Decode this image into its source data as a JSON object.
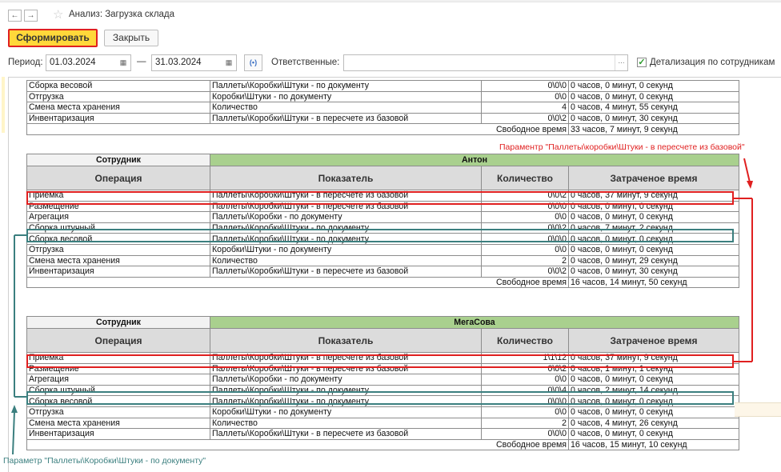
{
  "window": {
    "title": "Анализ: Загрузка склада"
  },
  "toolbar": {
    "generate_label": "Сформировать",
    "close_label": "Закрыть"
  },
  "filters": {
    "period_label": "Период:",
    "date_from": "01.03.2024",
    "dash": "—",
    "date_to": "31.03.2024",
    "responsible_label": "Ответственные:",
    "responsible_value": "",
    "detail_label": "Детализация по сотрудникам",
    "detail_checked": true
  },
  "columns": {
    "employee": "Сотрудник",
    "operation": "Операция",
    "indicator": "Показатель",
    "quantity": "Количество",
    "time": "Затраченое время"
  },
  "free_time_label": "Свободное время",
  "block0": {
    "rows": [
      {
        "operation": "Сборка весовой",
        "indicator": "Паллеты\\Коробки\\Штуки - по документу",
        "quantity": "0\\0\\0",
        "time": "0 часов, 0 минут, 0 секунд"
      },
      {
        "operation": "Отгрузка",
        "indicator": "Коробки\\Штуки - по документу",
        "quantity": "0\\0",
        "time": "0 часов, 0 минут, 0 секунд"
      },
      {
        "operation": "Смена места хранения",
        "indicator": "Количество",
        "quantity": "4",
        "time": "0 часов, 4 минут, 55 секунд"
      },
      {
        "operation": "Инвентаризация",
        "indicator": "Паллеты\\Коробки\\Штуки - в пересчете из базовой",
        "quantity": "0\\0\\2",
        "time": "0 часов, 0 минут, 30 секунд"
      }
    ],
    "free_time": "33 часов, 7 минут, 9 секунд"
  },
  "block1": {
    "employee": "Антон",
    "rows": [
      {
        "operation": "Приемка",
        "indicator": "Паллеты\\Коробки\\Штуки - в пересчете из базовой",
        "quantity": "0\\0\\2",
        "time": "0 часов, 37 минут, 9 секунд"
      },
      {
        "operation": "Размещение",
        "indicator": "Паллеты\\Коробки\\Штуки - в пересчете из базовой",
        "quantity": "0\\0\\0",
        "time": "0 часов, 0 минут, 0 секунд"
      },
      {
        "operation": "Агрегация",
        "indicator": "Паллеты\\Коробки - по документу",
        "quantity": "0\\0",
        "time": "0 часов, 0 минут, 0 секунд"
      },
      {
        "operation": "Сборка штучный",
        "indicator": "Паллеты\\Коробки\\Штуки - по документу",
        "quantity": "0\\0\\2",
        "time": "0 часов, 7 минут, 2 секунд"
      },
      {
        "operation": "Сборка весовой",
        "indicator": "Паллеты\\Коробки\\Штуки - по документу",
        "quantity": "0\\0\\0",
        "time": "0 часов, 0 минут, 0 секунд"
      },
      {
        "operation": "Отгрузка",
        "indicator": "Коробки\\Штуки - по документу",
        "quantity": "0\\0",
        "time": "0 часов, 0 минут, 0 секунд"
      },
      {
        "operation": "Смена места хранения",
        "indicator": "Количество",
        "quantity": "2",
        "time": "0 часов, 0 минут, 29 секунд"
      },
      {
        "operation": "Инвентаризация",
        "indicator": "Паллеты\\Коробки\\Штуки - в пересчете из базовой",
        "quantity": "0\\0\\2",
        "time": "0 часов, 0 минут, 30 секунд"
      }
    ],
    "free_time": "16 часов, 14 минут, 50 секунд"
  },
  "block2": {
    "employee": "МегаСова",
    "rows": [
      {
        "operation": "Приемка",
        "indicator": "Паллеты\\Коробки\\Штуки - в пересчете из базовой",
        "quantity": "1\\1\\12",
        "time": "0 часов, 37 минут, 9 секунд"
      },
      {
        "operation": "Размещение",
        "indicator": "Паллеты\\Коробки\\Штуки - в пересчете из базовой",
        "quantity": "0\\0\\2",
        "time": "0 часов, 1 минут, 1 секунд"
      },
      {
        "operation": "Агрегация",
        "indicator": "Паллеты\\Коробки - по документу",
        "quantity": "0\\0",
        "time": "0 часов, 0 минут, 0 секунд"
      },
      {
        "operation": "Сборка штучный",
        "indicator": "Паллеты\\Коробки\\Штуки - по документу",
        "quantity": "0\\0\\4",
        "time": "0 часов, 2 минут, 14 секунд"
      },
      {
        "operation": "Сборка весовой",
        "indicator": "Паллеты\\Коробки\\Штуки - по документу",
        "quantity": "0\\0\\0",
        "time": "0 часов, 0 минут, 0 секунд"
      },
      {
        "operation": "Отгрузка",
        "indicator": "Коробки\\Штуки - по документу",
        "quantity": "0\\0",
        "time": "0 часов, 0 минут, 0 секунд"
      },
      {
        "operation": "Смена места хранения",
        "indicator": "Количество",
        "quantity": "2",
        "time": "0 часов, 4 минут, 26 секунд"
      },
      {
        "operation": "Инвентаризация",
        "indicator": "Паллеты\\Коробки\\Штуки - в пересчете из базовой",
        "quantity": "0\\0\\0",
        "time": "0 часов, 0 минут, 0 секунд"
      }
    ],
    "free_time": "16 часов, 15 минут, 10 секунд"
  },
  "annotations": {
    "red": "Параментр \"Паллеты\\коробки\\Штуки - в пересчете из базовой\"",
    "teal": "Параметр \"Паллеты\\Коробки\\Штуки - по документу\""
  },
  "colors": {
    "accent_button": "#ffd83a",
    "highlight_red": "#e02020",
    "highlight_teal": "#3b7f7f",
    "employee_header": "#a9d08e"
  },
  "icons": {
    "back": "arrow-left-icon",
    "forward": "arrow-right-icon",
    "favorite": "star-icon",
    "calendar": "calendar-icon",
    "select": "ellipsis-icon",
    "period": "broadcast-icon"
  }
}
